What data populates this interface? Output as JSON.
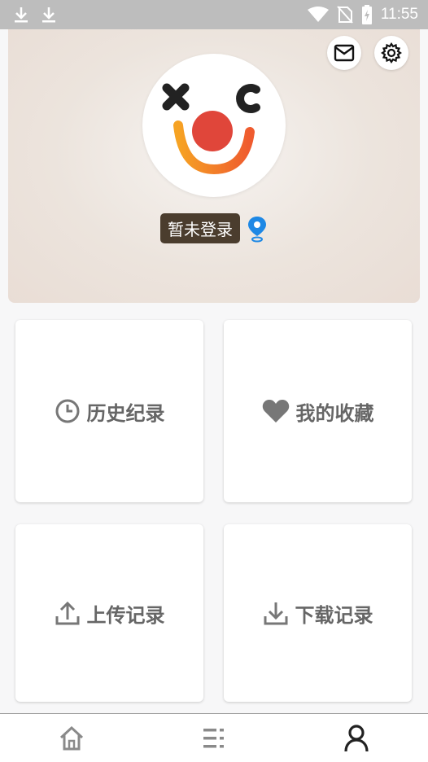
{
  "status_bar": {
    "time": "11:55",
    "left_icons": [
      "download-icon",
      "download-icon"
    ],
    "right_icons": [
      "wifi-icon",
      "no-sim-icon",
      "battery-charging-icon"
    ]
  },
  "header": {
    "background_color": "#ece4dd",
    "login_text": "暂未登录",
    "login_badge_color": "#4b3d2e",
    "location_icon_color": "#1e88e5",
    "actions": [
      "mail-icon",
      "settings-icon"
    ],
    "avatar": "clown-face-avatar"
  },
  "cards": [
    {
      "id": "history",
      "label": "历史纪录",
      "icon": "clock-icon"
    },
    {
      "id": "favorites",
      "label": "我的收藏",
      "icon": "heart-icon"
    },
    {
      "id": "uploads",
      "label": "上传记录",
      "icon": "upload-icon"
    },
    {
      "id": "downloads",
      "label": "下载记录",
      "icon": "download-icon"
    }
  ],
  "bottom_nav": {
    "items": [
      {
        "id": "home",
        "icon": "home-icon",
        "active": false
      },
      {
        "id": "categories",
        "icon": "list-icon",
        "active": false
      },
      {
        "id": "profile",
        "icon": "person-icon",
        "active": true
      }
    ],
    "active_color": "#222222",
    "inactive_color": "#8a8a8a"
  }
}
